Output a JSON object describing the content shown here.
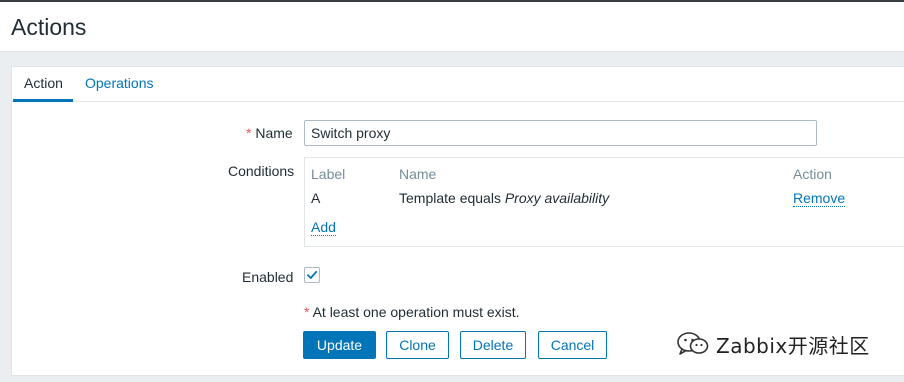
{
  "header": {
    "title": "Actions"
  },
  "tabs": [
    {
      "label": "Action",
      "active": true
    },
    {
      "label": "Operations",
      "active": false
    }
  ],
  "form": {
    "name": {
      "required_mark": "*",
      "label": "Name",
      "value": "Switch proxy"
    },
    "conditions": {
      "label": "Conditions",
      "columns": [
        "Label",
        "Name",
        "Action"
      ],
      "rows": [
        {
          "label": "A",
          "name_prefix": "Template equals ",
          "name_italic": "Proxy availability",
          "action": "Remove"
        }
      ],
      "add_link": "Add"
    },
    "enabled": {
      "label": "Enabled",
      "checked": true
    },
    "warning": {
      "required_mark": "*",
      "text": " At least one operation must exist."
    },
    "buttons": {
      "update": "Update",
      "clone": "Clone",
      "delete": "Delete",
      "cancel": "Cancel"
    }
  },
  "watermark": {
    "text": "Zabbix开源社区",
    "icon": "wechat-icon"
  },
  "colors": {
    "accent": "#0275b8",
    "required": "#e45959",
    "muted": "#768d99"
  }
}
